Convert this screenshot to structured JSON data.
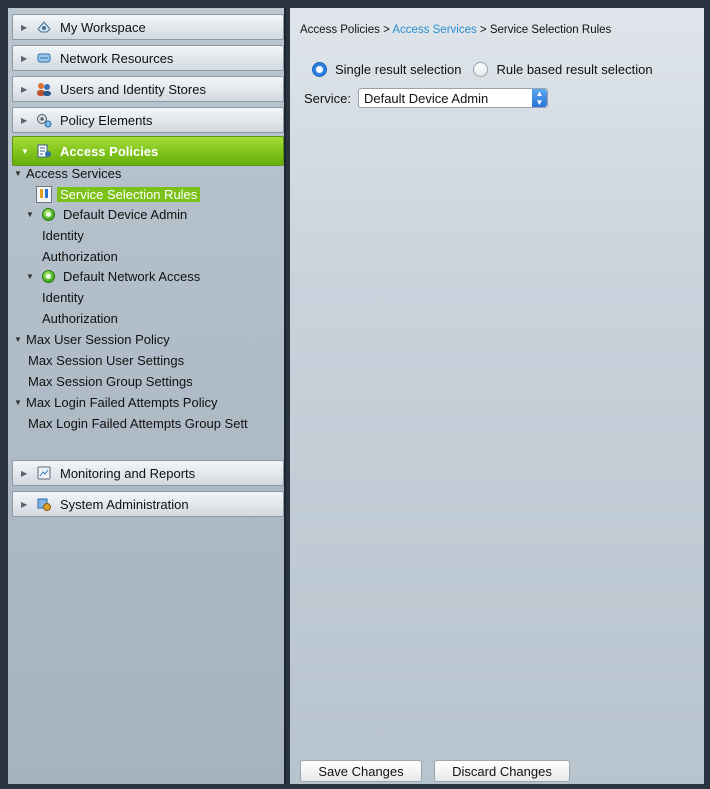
{
  "sidebar": {
    "drawers": [
      {
        "label": "My Workspace",
        "icon": "workspace-icon"
      },
      {
        "label": "Network Resources",
        "icon": "network-resources-icon"
      },
      {
        "label": "Users and Identity Stores",
        "icon": "users-icon"
      },
      {
        "label": "Policy Elements",
        "icon": "policy-elements-icon"
      },
      {
        "label": "Access Policies",
        "icon": "access-policies-icon"
      },
      {
        "label": "Monitoring and Reports",
        "icon": "monitoring-icon"
      },
      {
        "label": "System Administration",
        "icon": "system-admin-icon"
      }
    ],
    "tree": {
      "access_services": "Access Services",
      "service_selection_rules": "Service Selection Rules",
      "default_device_admin": "Default Device Admin",
      "dda_identity": "Identity",
      "dda_authorization": "Authorization",
      "default_network_access": "Default Network Access",
      "dna_identity": "Identity",
      "dna_authorization": "Authorization",
      "max_user_session_policy": "Max User Session Policy",
      "max_session_user_settings": "Max Session User Settings",
      "max_session_group_settings": "Max Session Group Settings",
      "max_login_failed_attempts_policy": "Max Login Failed Attempts Policy",
      "max_login_failed_attempts_group": "Max Login Failed Attempts Group Sett"
    }
  },
  "main": {
    "breadcrumb": {
      "part1": "Access Policies",
      "sep1": " > ",
      "part2": "Access Services",
      "sep2": " > ",
      "part3": "Service Selection Rules"
    },
    "selection_mode": {
      "single_label": "Single result selection",
      "rule_based_label": "Rule based result selection",
      "selected": "single"
    },
    "service": {
      "label": "Service:",
      "value": "Default Device Admin"
    },
    "buttons": {
      "save": "Save Changes",
      "discard": "Discard Changes"
    }
  },
  "colors": {
    "active_drawer": "#7cc118",
    "link": "#2a8fd0",
    "radio_selected": "#2b7fe0"
  }
}
